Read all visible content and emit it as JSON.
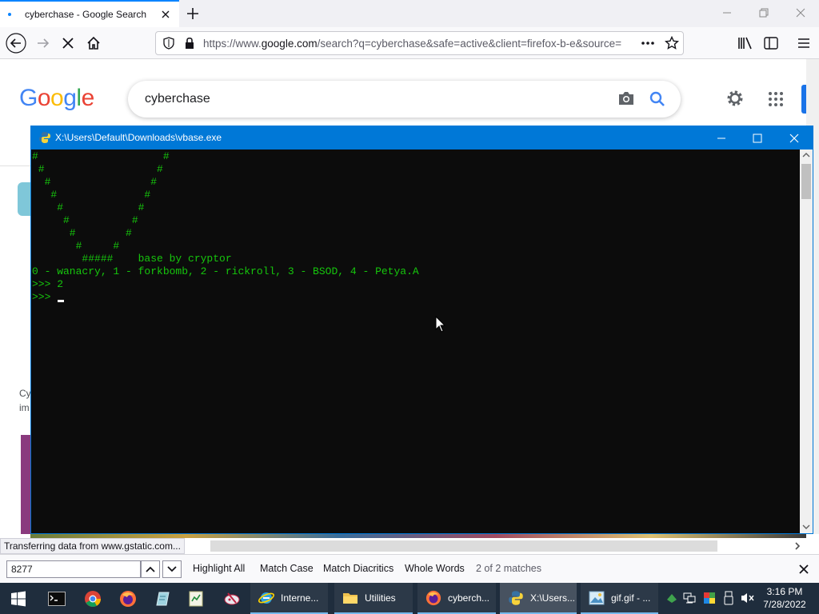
{
  "browser": {
    "tab_title": "cyberchase - Google Search",
    "url_prefix": "https://www.",
    "url_domain": "google.com",
    "url_rest": "/search?q=cyberchase&safe=active&client=firefox-b-e&source=",
    "icons": [
      "back-icon",
      "forward-icon",
      "stop-icon",
      "home-icon",
      "shield-icon",
      "lock-icon",
      "more-icon",
      "bookmark-star-icon",
      "library-icon",
      "sidebar-icon",
      "menu-icon"
    ]
  },
  "google": {
    "logo_letters": [
      "G",
      "o",
      "o",
      "g",
      "l",
      "e"
    ],
    "logo_colors": [
      "#4285f4",
      "#ea4335",
      "#fbbc05",
      "#4285f4",
      "#34a853",
      "#ea4335"
    ],
    "search_value": "cyberchase",
    "partial_text_1": "Cy",
    "partial_text_2": "im"
  },
  "console": {
    "title": "X:\\Users\\Default\\Downloads\\vbase.exe",
    "lines": [
      "#                    #",
      " #                  #",
      "  #                #",
      "   #              #",
      "    #            #",
      "     #          #",
      "      #        #",
      "       #     #",
      "        #####    base by cryptor",
      "0 - wanacry, 1 - forkbomb, 2 - rickroll, 3 - BSOD, 4 - Petya.A",
      ">>> 2",
      ">>> "
    ],
    "text_color": "#16c60c"
  },
  "status": {
    "text": "Transferring data from www.gstatic.com..."
  },
  "findbar": {
    "query": "8277",
    "highlight_all": "Highlight All",
    "match_case": "Match Case",
    "match_diacritics": "Match Diacritics",
    "whole_words": "Whole Words",
    "matches": "2 of 2 matches"
  },
  "taskbar": {
    "items": [
      {
        "label": "Interne...",
        "icon": "ie-icon"
      },
      {
        "label": "Utilities",
        "icon": "folder-icon"
      },
      {
        "label": "cyberch...",
        "icon": "firefox-icon"
      },
      {
        "label": "X:\\Users...",
        "icon": "console-icon"
      },
      {
        "label": "gif.gif - ...",
        "icon": "image-viewer-icon"
      }
    ],
    "time": "3:16 PM",
    "date": "7/28/2022"
  }
}
